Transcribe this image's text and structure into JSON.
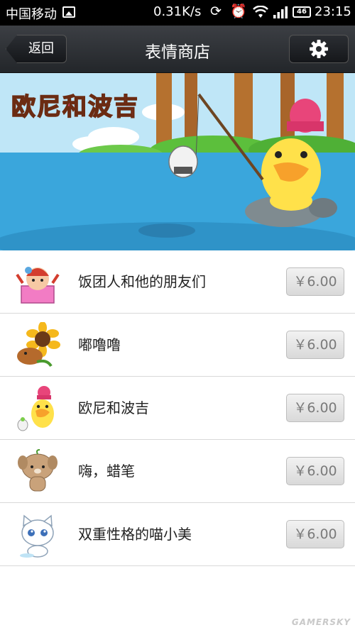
{
  "status_bar": {
    "carrier": "中国移动",
    "speed": "0.31K/s",
    "battery": "46",
    "time": "23:15",
    "icons": [
      "image-icon",
      "sync-icon",
      "alarm-icon",
      "wifi-icon",
      "signal-icon",
      "battery-icon"
    ]
  },
  "header": {
    "back_label": "返回",
    "title": "表情商店",
    "settings_icon": "gear-icon"
  },
  "banner": {
    "title": "欧尼和波吉"
  },
  "items": [
    {
      "name": "饭团人和他的朋友们",
      "price": "￥6.00",
      "thumb": "rice-ball-sticker"
    },
    {
      "name": "嘟噜噜",
      "price": "￥6.00",
      "thumb": "sunflower-sticker"
    },
    {
      "name": "欧尼和波吉",
      "price": "￥6.00",
      "thumb": "duck-sticker"
    },
    {
      "name": "嗨，蜡笔",
      "price": "￥6.00",
      "thumb": "bear-sticker"
    },
    {
      "name": "双重性格的喵小美",
      "price": "￥6.00",
      "thumb": "cat-sticker"
    }
  ],
  "watermark": "GAMERSKY",
  "colors": {
    "titlebar": "#2f3236",
    "sky": "#bfe6f7",
    "water": "#3aa6dc",
    "price_text": "#7a7a7a"
  }
}
